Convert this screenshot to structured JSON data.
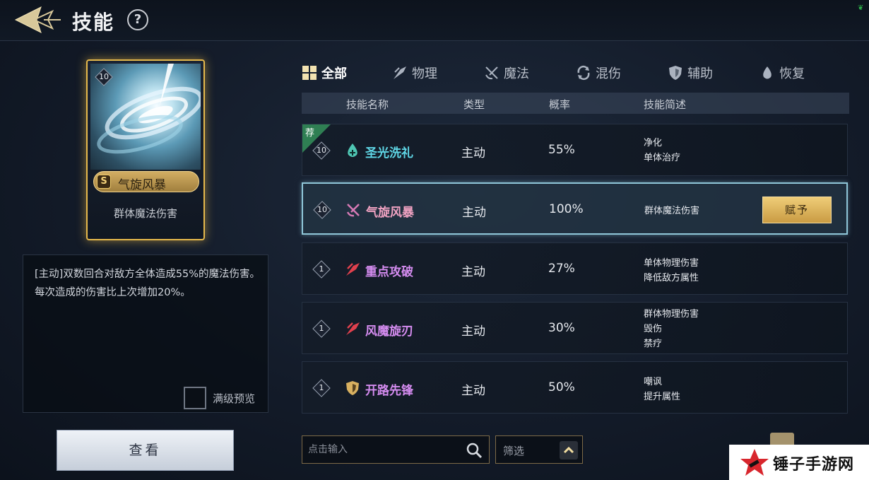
{
  "header": {
    "title": "技能",
    "help": "?"
  },
  "card": {
    "level": "10",
    "grade": "S",
    "name": "气旋风暴",
    "type": "群体魔法伤害"
  },
  "description": {
    "text": "[主动]双数回合对敌方全体造成55%的魔法伤害。每次造成的伤害比上次增加20%。",
    "max_preview_label": "满级预览"
  },
  "view_button": "查看",
  "tabs": [
    {
      "label": "全部",
      "icon": "grid-icon",
      "active": true
    },
    {
      "label": "物理",
      "icon": "claw-icon",
      "active": false
    },
    {
      "label": "魔法",
      "icon": "magic-cross-icon",
      "active": false
    },
    {
      "label": "混伤",
      "icon": "swirl-icon",
      "active": false
    },
    {
      "label": "辅助",
      "icon": "shield-icon",
      "active": false
    },
    {
      "label": "恢复",
      "icon": "drop-icon",
      "active": false
    }
  ],
  "table": {
    "headers": {
      "name": "技能名称",
      "type": "类型",
      "rate": "概率",
      "desc": "技能简述"
    },
    "rows": [
      {
        "level": "10",
        "name": "圣光洗礼",
        "name_color": "#5fd6e6",
        "icon": "heal-drop-icon",
        "type": "主动",
        "rate": "55%",
        "desc": [
          "净化",
          "单体治疗"
        ],
        "recommended": true
      },
      {
        "level": "10",
        "name": "气旋风暴",
        "name_color": "#f0a2c2",
        "icon": "magic-cross-icon",
        "type": "主动",
        "rate": "100%",
        "desc": [
          "群体魔法伤害"
        ],
        "selected": true
      },
      {
        "level": "1",
        "name": "重点攻破",
        "name_color": "#d58cf0",
        "icon": "claw-icon",
        "type": "主动",
        "rate": "27%",
        "desc": [
          "单体物理伤害",
          "降低敌方属性"
        ]
      },
      {
        "level": "1",
        "name": "风魔旋刃",
        "name_color": "#d58cf0",
        "icon": "claw-icon",
        "type": "主动",
        "rate": "30%",
        "desc": [
          "群体物理伤害",
          "毁伤",
          "禁疗"
        ]
      },
      {
        "level": "1",
        "name": "开路先锋",
        "name_color": "#d58cf0",
        "icon": "shield-icon",
        "type": "主动",
        "rate": "50%",
        "desc": [
          "嘲讽",
          "提升属性"
        ]
      }
    ],
    "recommend_tag": "荐",
    "grant_button": "赋予"
  },
  "search": {
    "placeholder": "点击输入"
  },
  "filter": {
    "label": "筛选"
  },
  "watermark": {
    "text": "锤子手游网"
  }
}
